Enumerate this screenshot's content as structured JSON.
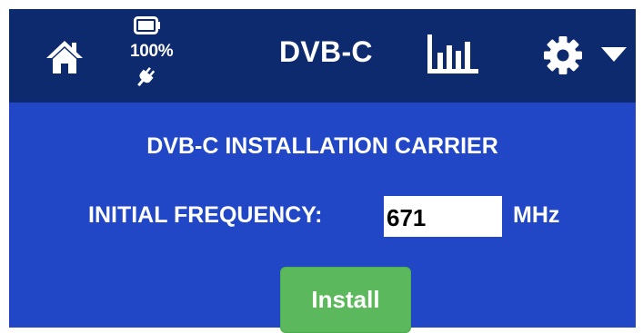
{
  "header": {
    "home_icon": "home-icon",
    "battery": {
      "icon": "battery-icon",
      "percent": "100%",
      "charging_icon": "plug-icon"
    },
    "mode": "DVB-C",
    "spectrum_icon": "bar-chart-icon",
    "settings_icon": "gear-icon",
    "settings_dropdown_icon": "caret-down-icon"
  },
  "main": {
    "title": "DVB-C INSTALLATION CARRIER",
    "frequency_label": "INITIAL FREQUENCY:",
    "frequency_value": "671",
    "frequency_unit": "MHz",
    "install_label": "Install"
  },
  "colors": {
    "header_bg": "#0e2a6e",
    "panel_bg": "#2146c6",
    "install_button": "#5cb85c",
    "text": "#ffffff"
  }
}
